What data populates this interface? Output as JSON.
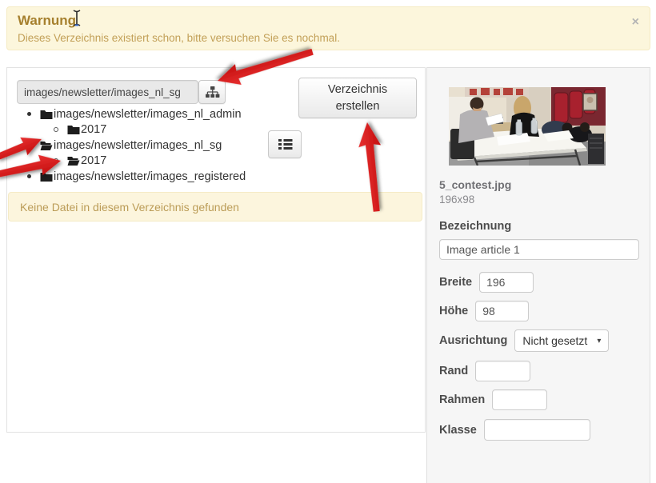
{
  "warning": {
    "title": "Warnung",
    "message": "Dieses Verzeichnis existiert schon, bitte versuchen Sie es nochmal.",
    "close_glyph": "×"
  },
  "file_manager": {
    "path_input": {
      "value": "images/newsletter/images_nl_sg"
    },
    "create_button_label": "Verzeichnis erstellen",
    "tree": [
      {
        "label": "images/newsletter/images_nl_admin",
        "state": "closed",
        "level": 1
      },
      {
        "label": "2017",
        "state": "closed",
        "level": 2
      },
      {
        "label": "images/newsletter/images_nl_sg",
        "state": "open",
        "level": 1
      },
      {
        "label": "2017",
        "state": "open",
        "level": 2
      },
      {
        "label": "images/newsletter/images_registered",
        "state": "closed",
        "level": 1
      }
    ],
    "empty_message": "Keine Datei in diesem Verzeichnis gefunden"
  },
  "details": {
    "filename": "5_contest.jpg",
    "dimensions": "196x98",
    "fields": {
      "bezeichnung": {
        "label": "Bezeichnung",
        "value": "Image article 1"
      },
      "breite": {
        "label": "Breite",
        "value": "196"
      },
      "hoehe": {
        "label": "Höhe",
        "value": "98"
      },
      "ausrichtung": {
        "label": "Ausrichtung",
        "value": "Nicht gesetzt",
        "caret": "▾"
      },
      "rand": {
        "label": "Rand",
        "value": ""
      },
      "rahmen": {
        "label": "Rahmen",
        "value": ""
      },
      "klasse": {
        "label": "Klasse",
        "value": ""
      }
    }
  },
  "icons": {
    "sitemap": "sitemap-icon",
    "list": "list-icon",
    "folder_closed": "folder-closed-icon",
    "folder_open": "folder-open-icon",
    "close": "close-icon",
    "text_cursor": "text-cursor-icon"
  },
  "colors": {
    "warning_bg": "#fcf6dc",
    "warning_border": "#f5ebc3",
    "warning_title": "#a6802e",
    "warning_text": "#c2a058",
    "annotation_arrow": "#d81c1c",
    "sidebar_bg": "#f6f6f6",
    "panel_border": "#e2e2e2"
  }
}
